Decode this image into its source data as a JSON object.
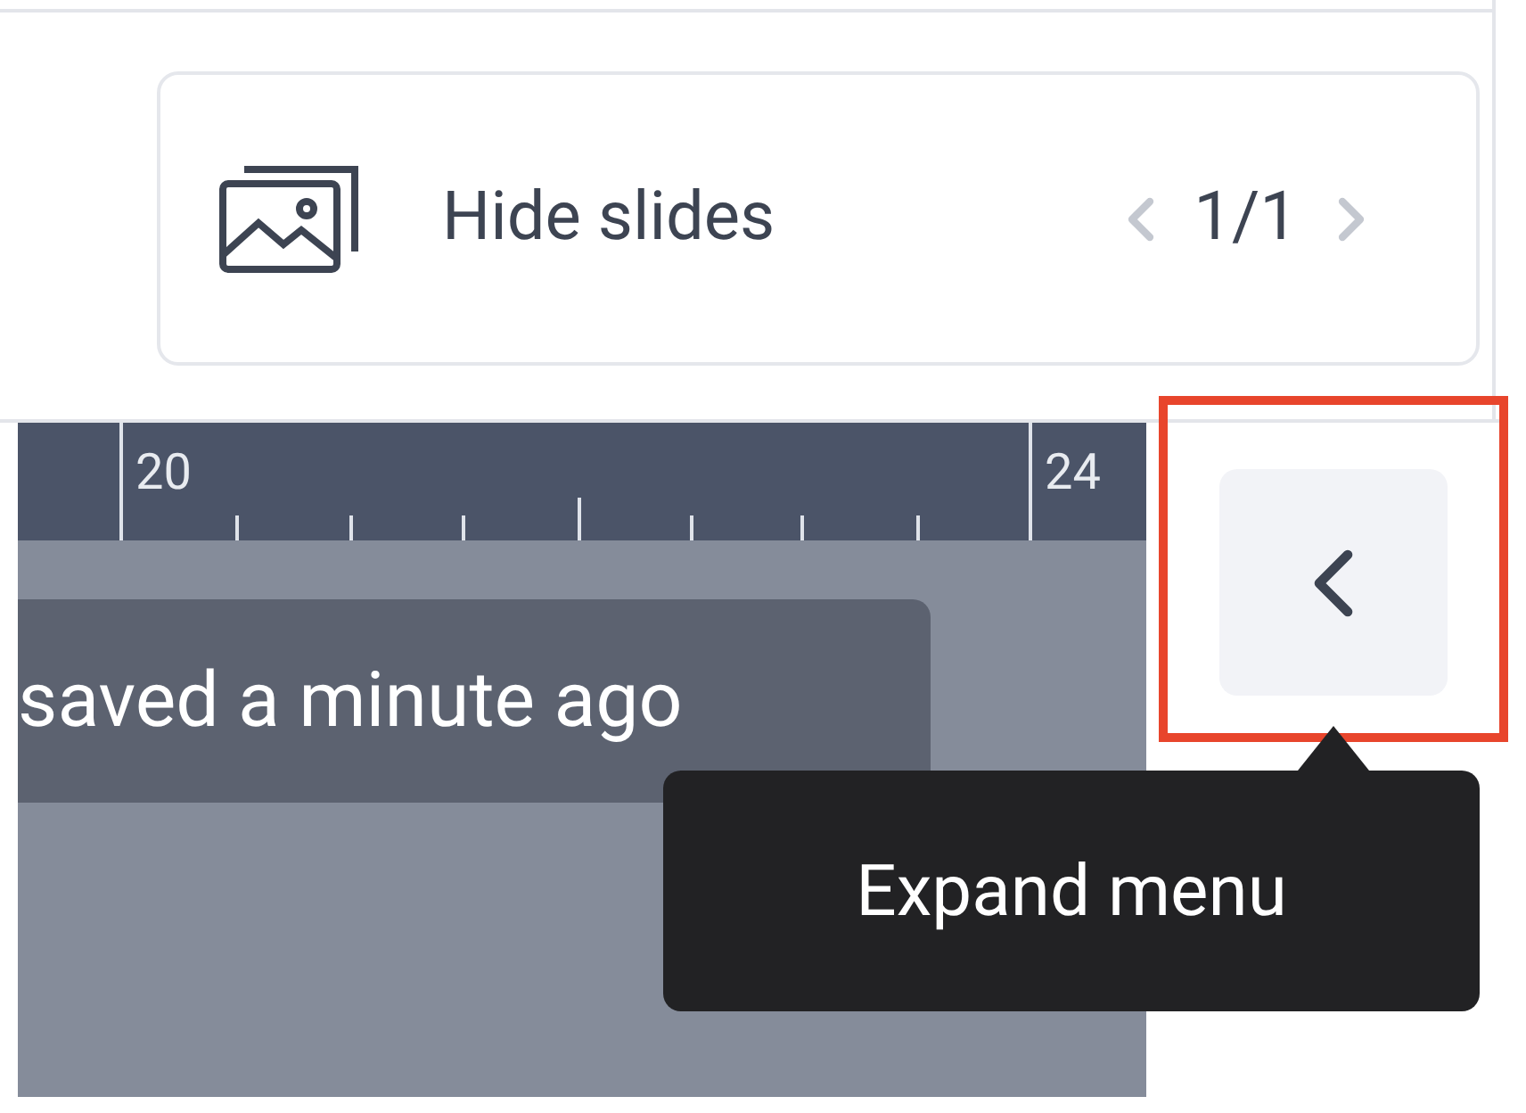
{
  "slides_panel": {
    "toggle_label": "Hide slides",
    "page_indicator": "1/1"
  },
  "ruler": {
    "labels": [
      "20",
      "24"
    ]
  },
  "toast": {
    "text": "saved a minute ago"
  },
  "expand_button": {
    "highlighted": true
  },
  "tooltip": {
    "text": "Expand menu"
  }
}
